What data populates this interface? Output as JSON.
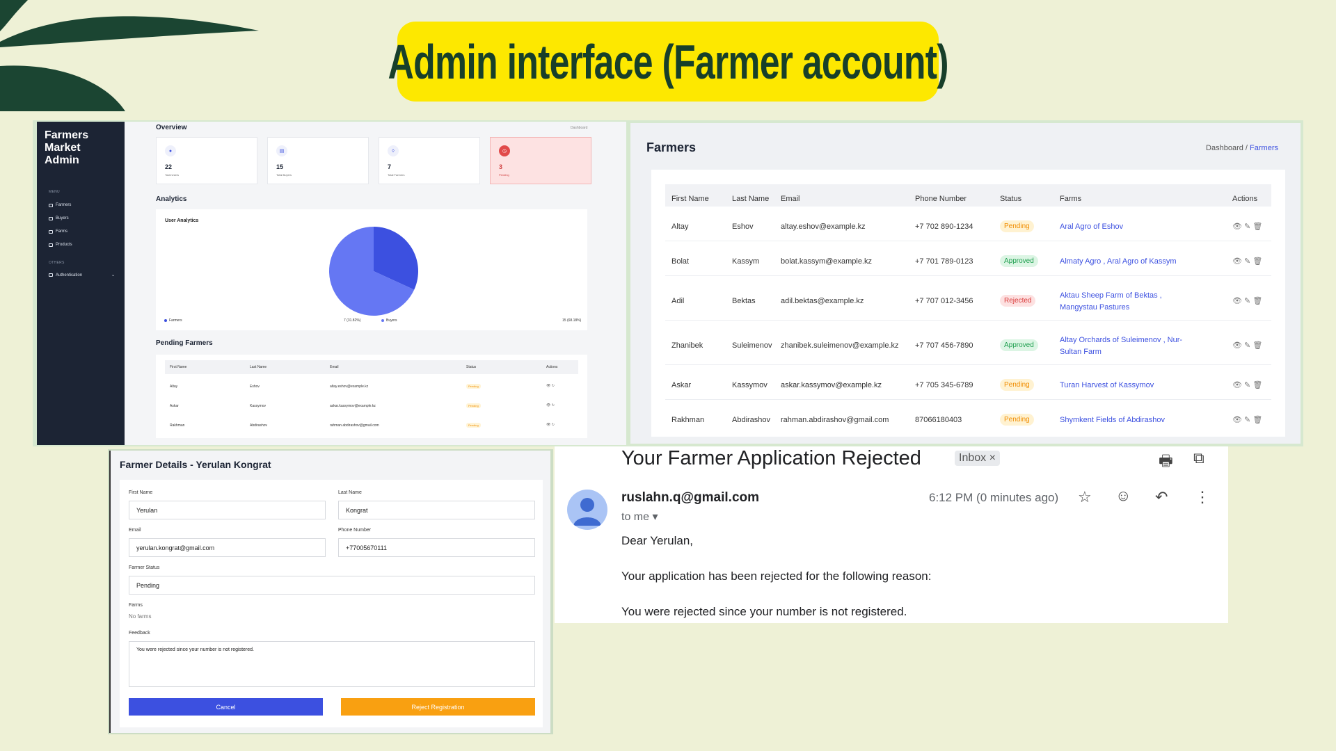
{
  "slide_title": "Admin interface (Farmer account)",
  "dashboard": {
    "brand": "Farmers Market Admin",
    "menu_label": "MENU",
    "menu_items": [
      "Farmers",
      "Buyers",
      "Farms",
      "Products"
    ],
    "others_label": "OTHERS",
    "others_items": [
      "Authentication"
    ],
    "overview_title": "Overview",
    "breadcrumb": "Dashboard",
    "cards": [
      {
        "value": "22",
        "label": "Total Users"
      },
      {
        "value": "15",
        "label": "Total Buyers"
      },
      {
        "value": "7",
        "label": "Total Farmers"
      },
      {
        "value": "3",
        "label": "Pending"
      }
    ],
    "analytics_title": "Analytics",
    "user_analytics_title": "User Analytics",
    "chart_data": {
      "type": "pie",
      "title": "User Analytics",
      "categories": [
        "Farmers",
        "Buyers"
      ],
      "values": [
        7,
        15
      ],
      "labels": [
        "7 (31.82%)",
        "15 (68.18%)"
      ],
      "colors": [
        "#3c50e0",
        "#6577f3"
      ]
    },
    "pending_title": "Pending Farmers",
    "pending_columns": [
      "First Name",
      "Last Name",
      "Email",
      "Status",
      "Actions"
    ],
    "pending_rows": [
      [
        "Altay",
        "Eshov",
        "altay.eshov@example.kz",
        "Pending"
      ],
      [
        "Askar",
        "Kassymov",
        "askar.kassymov@example.kz",
        "Pending"
      ],
      [
        "Rakhman",
        "Abdirashov",
        "rahman.abdirashov@gmail.com",
        "Pending"
      ]
    ]
  },
  "farmers": {
    "title": "Farmers",
    "crumb_home": "Dashboard /",
    "crumb_current": "Farmers",
    "columns": [
      "First Name",
      "Last Name",
      "Email",
      "Phone Number",
      "Status",
      "Farms",
      "Actions"
    ],
    "rows": [
      {
        "first": "Altay",
        "last": "Eshov",
        "email": "altay.eshov@example.kz",
        "phone": "+7 702 890-1234",
        "status": "Pending",
        "farms": "Aral Agro of Eshov",
        "farms2": ""
      },
      {
        "first": "Bolat",
        "last": "Kassym",
        "email": "bolat.kassym@example.kz",
        "phone": "+7 701 789-0123",
        "status": "Approved",
        "farms": "Almaty Agro , Aral Agro of Kassym",
        "farms2": ""
      },
      {
        "first": "Adil",
        "last": "Bektas",
        "email": "adil.bektas@example.kz",
        "phone": "+7 707 012-3456",
        "status": "Rejected",
        "farms": "Aktau Sheep Farm of Bektas ,",
        "farms2": "Mangystau Pastures"
      },
      {
        "first": "Zhanibek",
        "last": "Suleimenov",
        "email": "zhanibek.suleimenov@example.kz",
        "phone": "+7 707 456-7890",
        "status": "Approved",
        "farms": "Altay Orchards of Suleimenov , Nur-",
        "farms2": "Sultan Farm"
      },
      {
        "first": "Askar",
        "last": "Kassymov",
        "email": "askar.kassymov@example.kz",
        "phone": "+7 705 345-6789",
        "status": "Pending",
        "farms": "Turan Harvest of Kassymov",
        "farms2": ""
      },
      {
        "first": "Rakhman",
        "last": "Abdirashov",
        "email": "rahman.abdirashov@gmail.com",
        "phone": "87066180403",
        "status": "Pending",
        "farms": "Shymkent Fields of Abdirashov",
        "farms2": ""
      }
    ]
  },
  "details": {
    "title": "Farmer Details - Yerulan Kongrat",
    "first_label": "First Name",
    "first_value": "Yerulan",
    "last_label": "Last Name",
    "last_value": "Kongrat",
    "email_label": "Email",
    "email_value": "yerulan.kongrat@gmail.com",
    "phone_label": "Phone Number",
    "phone_value": "+77005670111",
    "status_label": "Farmer Status",
    "status_value": "Pending",
    "farms_label": "Farms",
    "farms_value": "No farms",
    "feedback_label": "Feedback",
    "feedback_value": "You were rejected since your number is not registered.",
    "cancel": "Cancel",
    "reject": "Reject Registration"
  },
  "email": {
    "subject": "Your Farmer Application Rejected",
    "inbox": "Inbox ×",
    "sender": "ruslahn.q@gmail.com",
    "to": "to me",
    "time": "6:12 PM (0 minutes ago)",
    "greeting": "Dear Yerulan,",
    "line1": "Your application has been rejected for the following reason:",
    "line2": "You were rejected since your number is not registered."
  }
}
